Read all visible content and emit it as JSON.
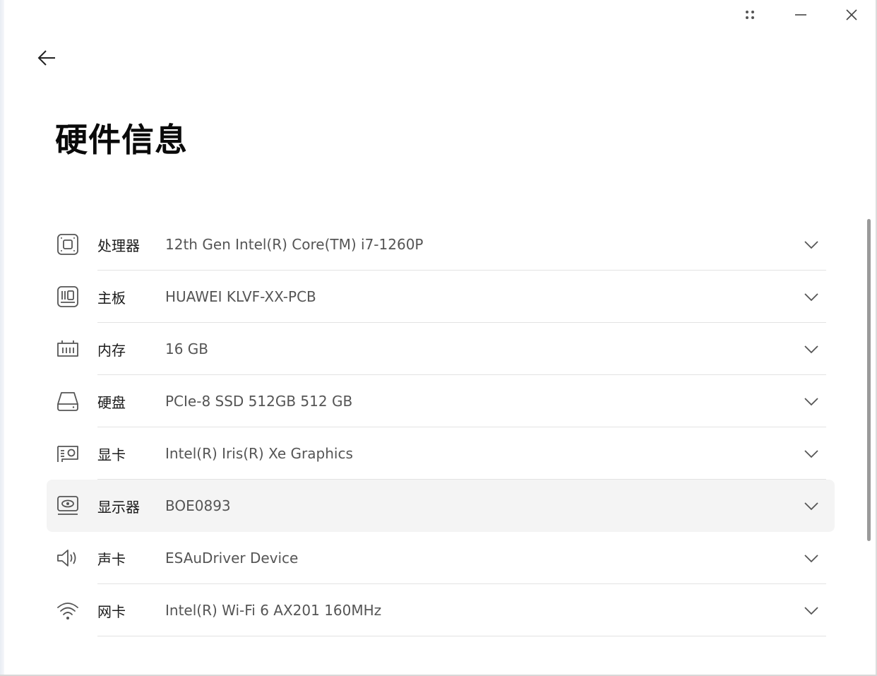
{
  "window": {
    "controls": {
      "more": "more-icon",
      "minimize": "minimize-icon",
      "close": "close-icon"
    }
  },
  "page": {
    "title": "硬件信息",
    "back_icon": "arrow-left-icon"
  },
  "hardware": [
    {
      "key": "cpu",
      "icon": "cpu-icon",
      "label": "处理器",
      "value": "12th Gen Intel(R) Core(TM) i7-1260P"
    },
    {
      "key": "motherboard",
      "icon": "motherboard-icon",
      "label": "主板",
      "value": "HUAWEI KLVF-XX-PCB"
    },
    {
      "key": "memory",
      "icon": "memory-icon",
      "label": "内存",
      "value": "16 GB"
    },
    {
      "key": "disk",
      "icon": "disk-icon",
      "label": "硬盘",
      "value": "PCIe-8 SSD 512GB 512 GB"
    },
    {
      "key": "gpu",
      "icon": "gpu-icon",
      "label": "显卡",
      "value": "Intel(R) Iris(R) Xe Graphics"
    },
    {
      "key": "monitor",
      "icon": "monitor-icon",
      "label": "显示器",
      "value": "BOE0893"
    },
    {
      "key": "sound",
      "icon": "speaker-icon",
      "label": "声卡",
      "value": "ESAuDriver Device"
    },
    {
      "key": "network",
      "icon": "wifi-icon",
      "label": "网卡",
      "value": "Intel(R) Wi-Fi 6 AX201 160MHz"
    }
  ],
  "colors": {
    "accent_text": "#0a0a0a",
    "value_text": "#555555",
    "hover_row": "#f4f4f4"
  }
}
